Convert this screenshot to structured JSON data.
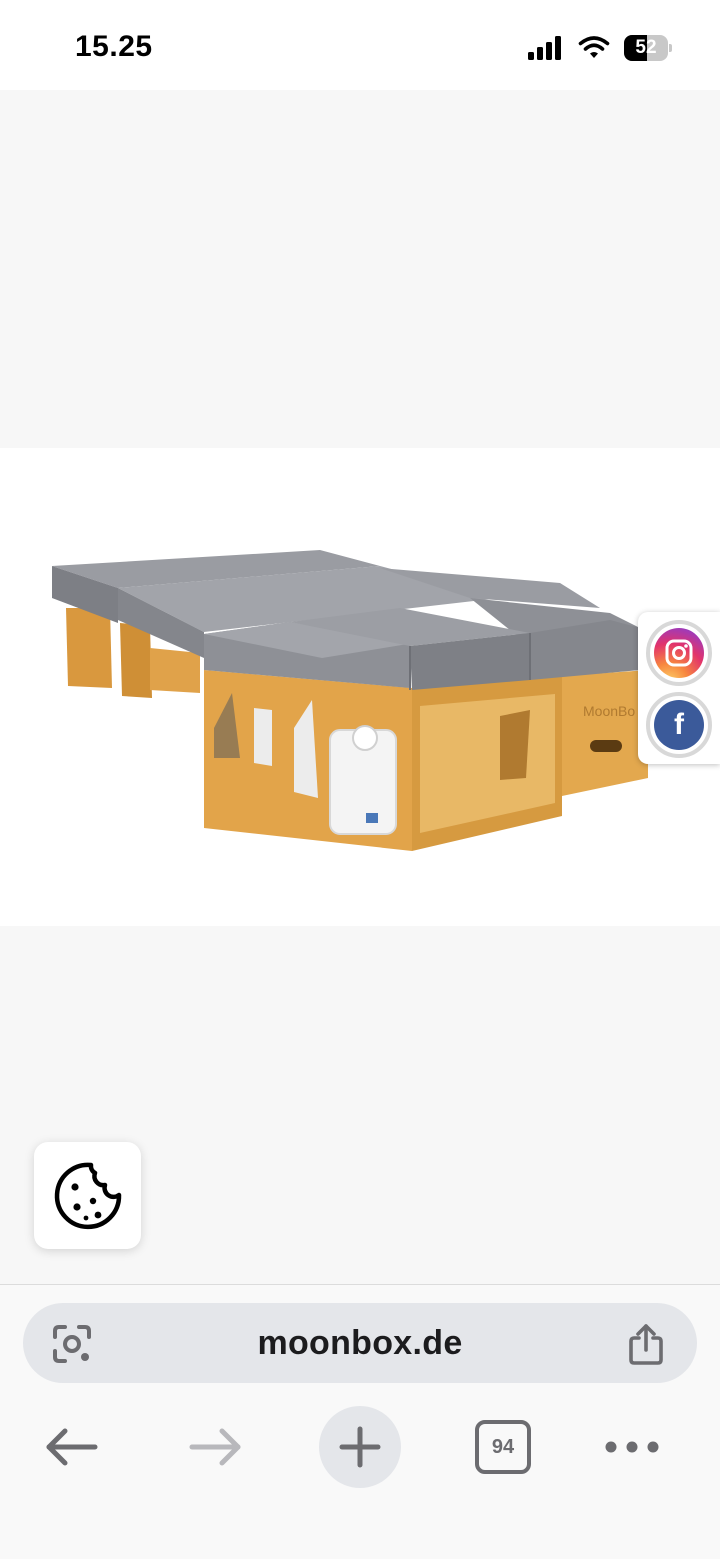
{
  "status_bar": {
    "time": "15.25",
    "battery_level": "52",
    "battery_fraction": 0.52,
    "signal_icon": "cellular-signal-icon",
    "wifi_icon": "wifi-icon",
    "battery_icon": "battery-icon"
  },
  "product": {
    "brand_mark": "MoonBo"
  },
  "social": {
    "instagram_icon": "instagram-icon",
    "facebook_icon": "facebook-icon",
    "facebook_glyph": "f"
  },
  "cookie": {
    "icon": "cookie-icon"
  },
  "browser": {
    "url": "moonbox.de",
    "tab_count": "94",
    "scan_icon": "page-scan-icon",
    "share_icon": "share-icon",
    "back_icon": "back-arrow-icon",
    "forward_icon": "forward-arrow-icon",
    "new_tab_icon": "plus-icon",
    "tabs_icon": "tabs-icon",
    "more_icon": "more-icon"
  },
  "colors": {
    "content_background": "#f7f7f7",
    "cushion_grey": "#8e9096",
    "wood": "#e2a44a",
    "facebook_blue": "#3b5a9a",
    "address_bar": "#e4e6ea"
  }
}
